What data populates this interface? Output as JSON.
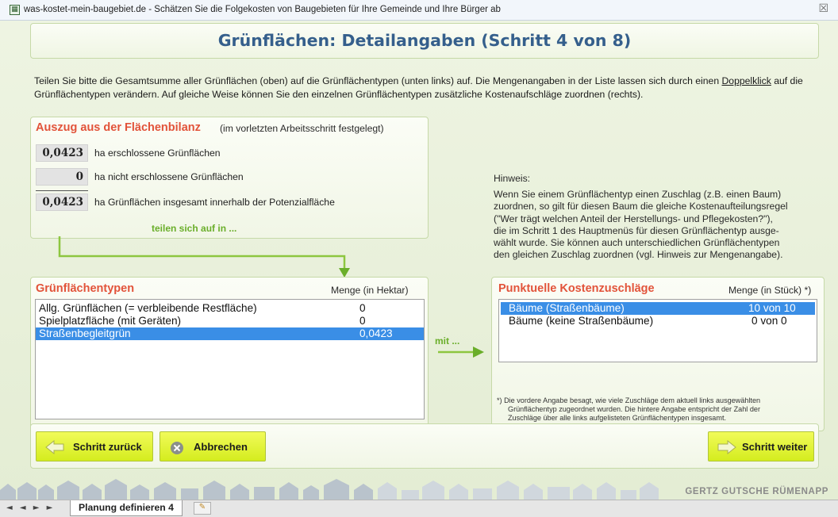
{
  "window": {
    "title": "was-kostet-mein-baugebiet.de - Schätzen Sie die Folgekosten von Baugebieten für Ihre Gemeinde und Ihre Bürger ab",
    "close_glyph": "☒"
  },
  "heading": "Grünflächen: Detailangaben (Schritt 4 von 8)",
  "intro": {
    "text1": "Teilen Sie bitte die Gesamtsumme aller Grünflächen (oben) auf die Grünflächentypen (unten links) auf. Die Mengenangaben in der Liste lassen sich durch einen",
    "link": "Doppelklick",
    "text2": " auf die Grünflächentypen verändern. Auf gleiche Weise können Sie den einzelnen Grünflächentypen zusätzliche Kostenaufschläge zuordnen (rechts)."
  },
  "bilanz": {
    "title": "Auszug aus der Flächenbilanz",
    "subtitle": "(im vorletzten Arbeitsschritt festgelegt)",
    "rows": [
      {
        "value": "0,0423",
        "label": "ha erschlossene Grünflächen"
      },
      {
        "value": "0",
        "label": "ha nicht erschlossene Grünflächen"
      },
      {
        "value": "0,0423",
        "label": "ha Grünflächen insgesamt innerhalb der Potenzialfläche"
      }
    ],
    "arrow_label": "teilen sich auf in ..."
  },
  "gruenflaechentypen": {
    "title": "Grünflächentypen",
    "column_header": "Menge (in Hektar)",
    "items": [
      {
        "name": "Allg. Grünflächen (= verbleibende Restfläche)",
        "value": "0",
        "selected": false
      },
      {
        "name": "Spielplatzfläche (mit Geräten)",
        "value": "0",
        "selected": false
      },
      {
        "name": "Straßenbegleitgrün",
        "value": "0,0423",
        "selected": true
      }
    ]
  },
  "mit_label": "mit ...",
  "hint": {
    "title": "Hinweis:",
    "lines": [
      "Wenn Sie einem Grünflächentyp einen Zuschlag (z.B. einen Baum)",
      "zuordnen, so gilt für diesen Baum die gleiche Kostenaufteilungsregel",
      "(\"Wer trägt welchen Anteil der Herstellungs- und Pflegekosten?\"),",
      "die im Schritt 1 des Hauptmenüs für diesen Grünflächentyp ausge-",
      "wählt wurde. Sie können auch unterschiedlichen Grünflächentypen",
      "den gleichen Zuschlag zuordnen (vgl. Hinweis zur Mengenangabe)."
    ]
  },
  "kostenzuschlaege": {
    "title": "Punktuelle Kostenzuschläge",
    "column_header": "Menge (in Stück) *)",
    "items": [
      {
        "name": "Bäume (Straßenbäume)",
        "value": "10 von 10",
        "selected": true
      },
      {
        "name": "Bäume (keine Straßenbäume)",
        "value": "0 von 0",
        "selected": false
      }
    ],
    "footnote_lines": [
      "*)  Die vordere Angabe besagt, wie viele Zuschläge dem aktuell links ausgewählten",
      "Grünflächentyp zugeordnet wurden. Die hintere Angabe entspricht der Zahl der",
      "Zuschläge über alle links aufgelisteten Grünflächentypen insgesamt."
    ]
  },
  "buttons": {
    "back": "Schritt zurück",
    "cancel": "Abbrechen",
    "next": "Schritt weiter"
  },
  "brand": "GERTZ GUTSCHE RÜMENAPP",
  "sheet_tabs": {
    "nav": "◄ ◄ ► ►",
    "active": "Planung definieren 4"
  },
  "colors": {
    "heading": "#355f8c",
    "section_title": "#e2533a",
    "accent_green": "#6aae2a",
    "selection": "#3a8ee6",
    "button": "#e6f53a"
  }
}
